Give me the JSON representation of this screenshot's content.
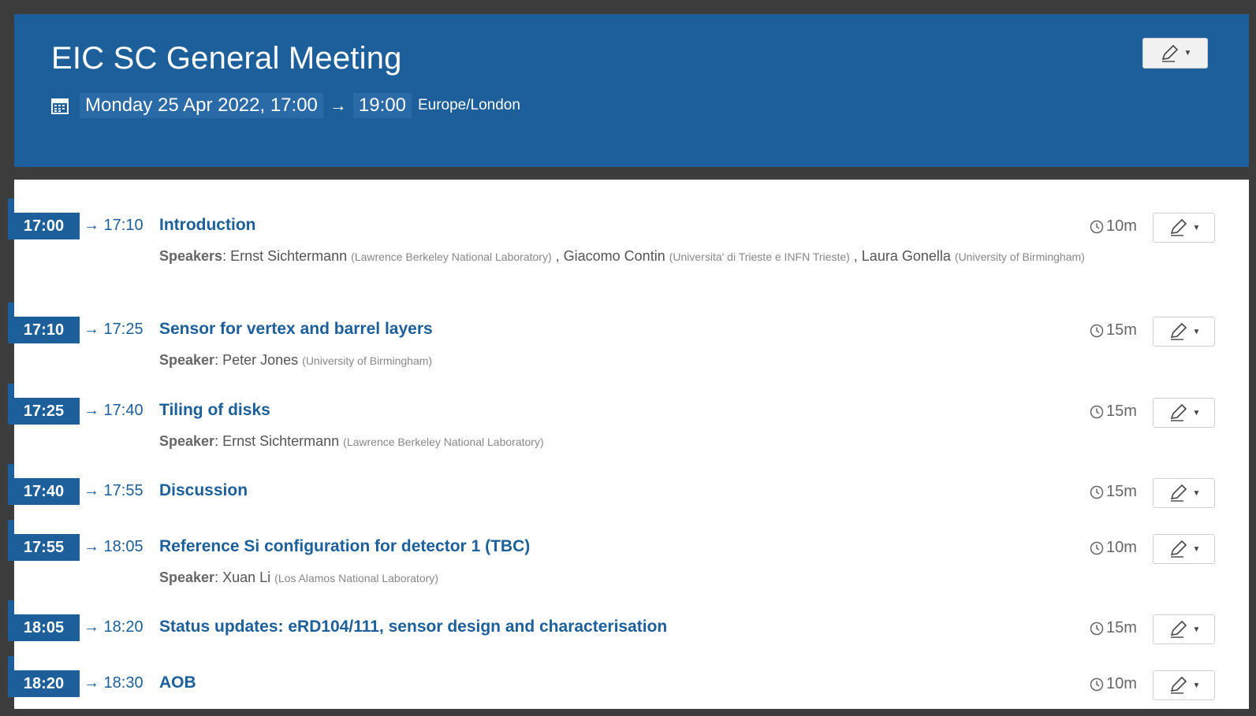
{
  "header": {
    "title": "EIC SC General Meeting",
    "date_start": "Monday 25 Apr 2022, 17:00",
    "arrow": "→",
    "date_end": "19:00",
    "timezone": "Europe/London"
  },
  "icons": {
    "calendar": "calendar-icon",
    "edit": "pencil-icon",
    "caret": "caret-down-icon",
    "clock": "clock-icon"
  },
  "entries": [
    {
      "start": "17:00",
      "end": "→ 17:10",
      "title": "Introduction",
      "duration": "10m",
      "speaker_label": "Speakers",
      "speakers": [
        {
          "name": "Ernst Sichtermann",
          "aff": "(Lawrence Berkeley National Laboratory)"
        },
        {
          "name": "Giacomo Contin",
          "aff": "(Universita' di Trieste e INFN Trieste)"
        },
        {
          "name": "Laura Gonella",
          "aff": "(University of Birmingham)"
        }
      ]
    },
    {
      "start": "17:10",
      "end": "→ 17:25",
      "title": "Sensor for vertex and barrel layers",
      "duration": "15m",
      "speaker_label": "Speaker",
      "speakers": [
        {
          "name": "Peter Jones",
          "aff": "(University of Birmingham)"
        }
      ]
    },
    {
      "start": "17:25",
      "end": "→ 17:40",
      "title": "Tiling of disks",
      "duration": "15m",
      "speaker_label": "Speaker",
      "speakers": [
        {
          "name": "Ernst Sichtermann",
          "aff": "(Lawrence Berkeley National Laboratory)"
        }
      ]
    },
    {
      "start": "17:40",
      "end": "→ 17:55",
      "title": "Discussion",
      "duration": "15m",
      "speaker_label": "",
      "speakers": []
    },
    {
      "start": "17:55",
      "end": "→ 18:05",
      "title": "Reference Si configuration for detector 1 (TBC)",
      "duration": "10m",
      "speaker_label": "Speaker",
      "speakers": [
        {
          "name": "Xuan Li",
          "aff": "(Los Alamos National Laboratory)"
        }
      ]
    },
    {
      "start": "18:05",
      "end": "→ 18:20",
      "title": "Status updates: eRD104/111, sensor design and characterisation",
      "duration": "15m",
      "speaker_label": "",
      "speakers": []
    },
    {
      "start": "18:20",
      "end": "→ 18:30",
      "title": "AOB",
      "duration": "10m",
      "speaker_label": "",
      "speakers": []
    }
  ]
}
